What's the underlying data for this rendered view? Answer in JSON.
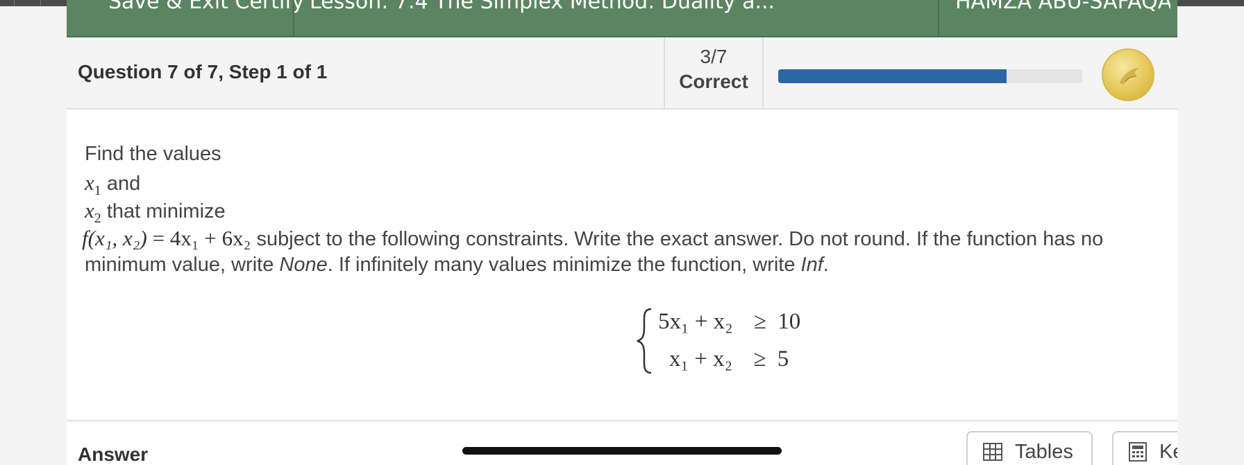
{
  "nav": {
    "save_exit": "Save & Exit Certify",
    "lesson": "Lesson: 7.4 The Simplex Method: Duality a...",
    "user": "HAMZA ABU-SAFAQAH"
  },
  "question": {
    "title": "Question 7 of 7, Step 1 of 1",
    "score_value": "3/7",
    "score_label": "Correct",
    "progress_percent": 75,
    "coin_icon": "badge-coin-icon"
  },
  "problem": {
    "line1": "Find the values",
    "var1": "x",
    "var1_sub": "1",
    "line2_rest": " and",
    "var2": "x",
    "var2_sub": "2",
    "line3_rest": " that minimize",
    "objective_prefix": "f",
    "objective_args": "(x₁, x₂)",
    "objective_eq": " = 4x₁ + 6x₂",
    "line4_rest": " subject to the following constraints. Write the exact answer. Do not round. If the function has no",
    "line5_a": "minimum value, write ",
    "line5_none": "None",
    "line5_b": ". If infinitely many values minimize the function, write ",
    "line5_inf": "Inf",
    "line5_c": "."
  },
  "constraints": [
    {
      "lhs": "5x₁ + x₂",
      "op": "≥",
      "rhs": "10"
    },
    {
      "lhs": "x₁ + x₂",
      "op": "≥",
      "rhs": "5"
    }
  ],
  "answer": {
    "label": "Answer",
    "tables_label": "Tables",
    "keypad_label": "Keypad"
  },
  "colors": {
    "nav_green": "#5b8462",
    "progress_blue": "#2b66a8",
    "coin_gold": "#e3c452"
  }
}
